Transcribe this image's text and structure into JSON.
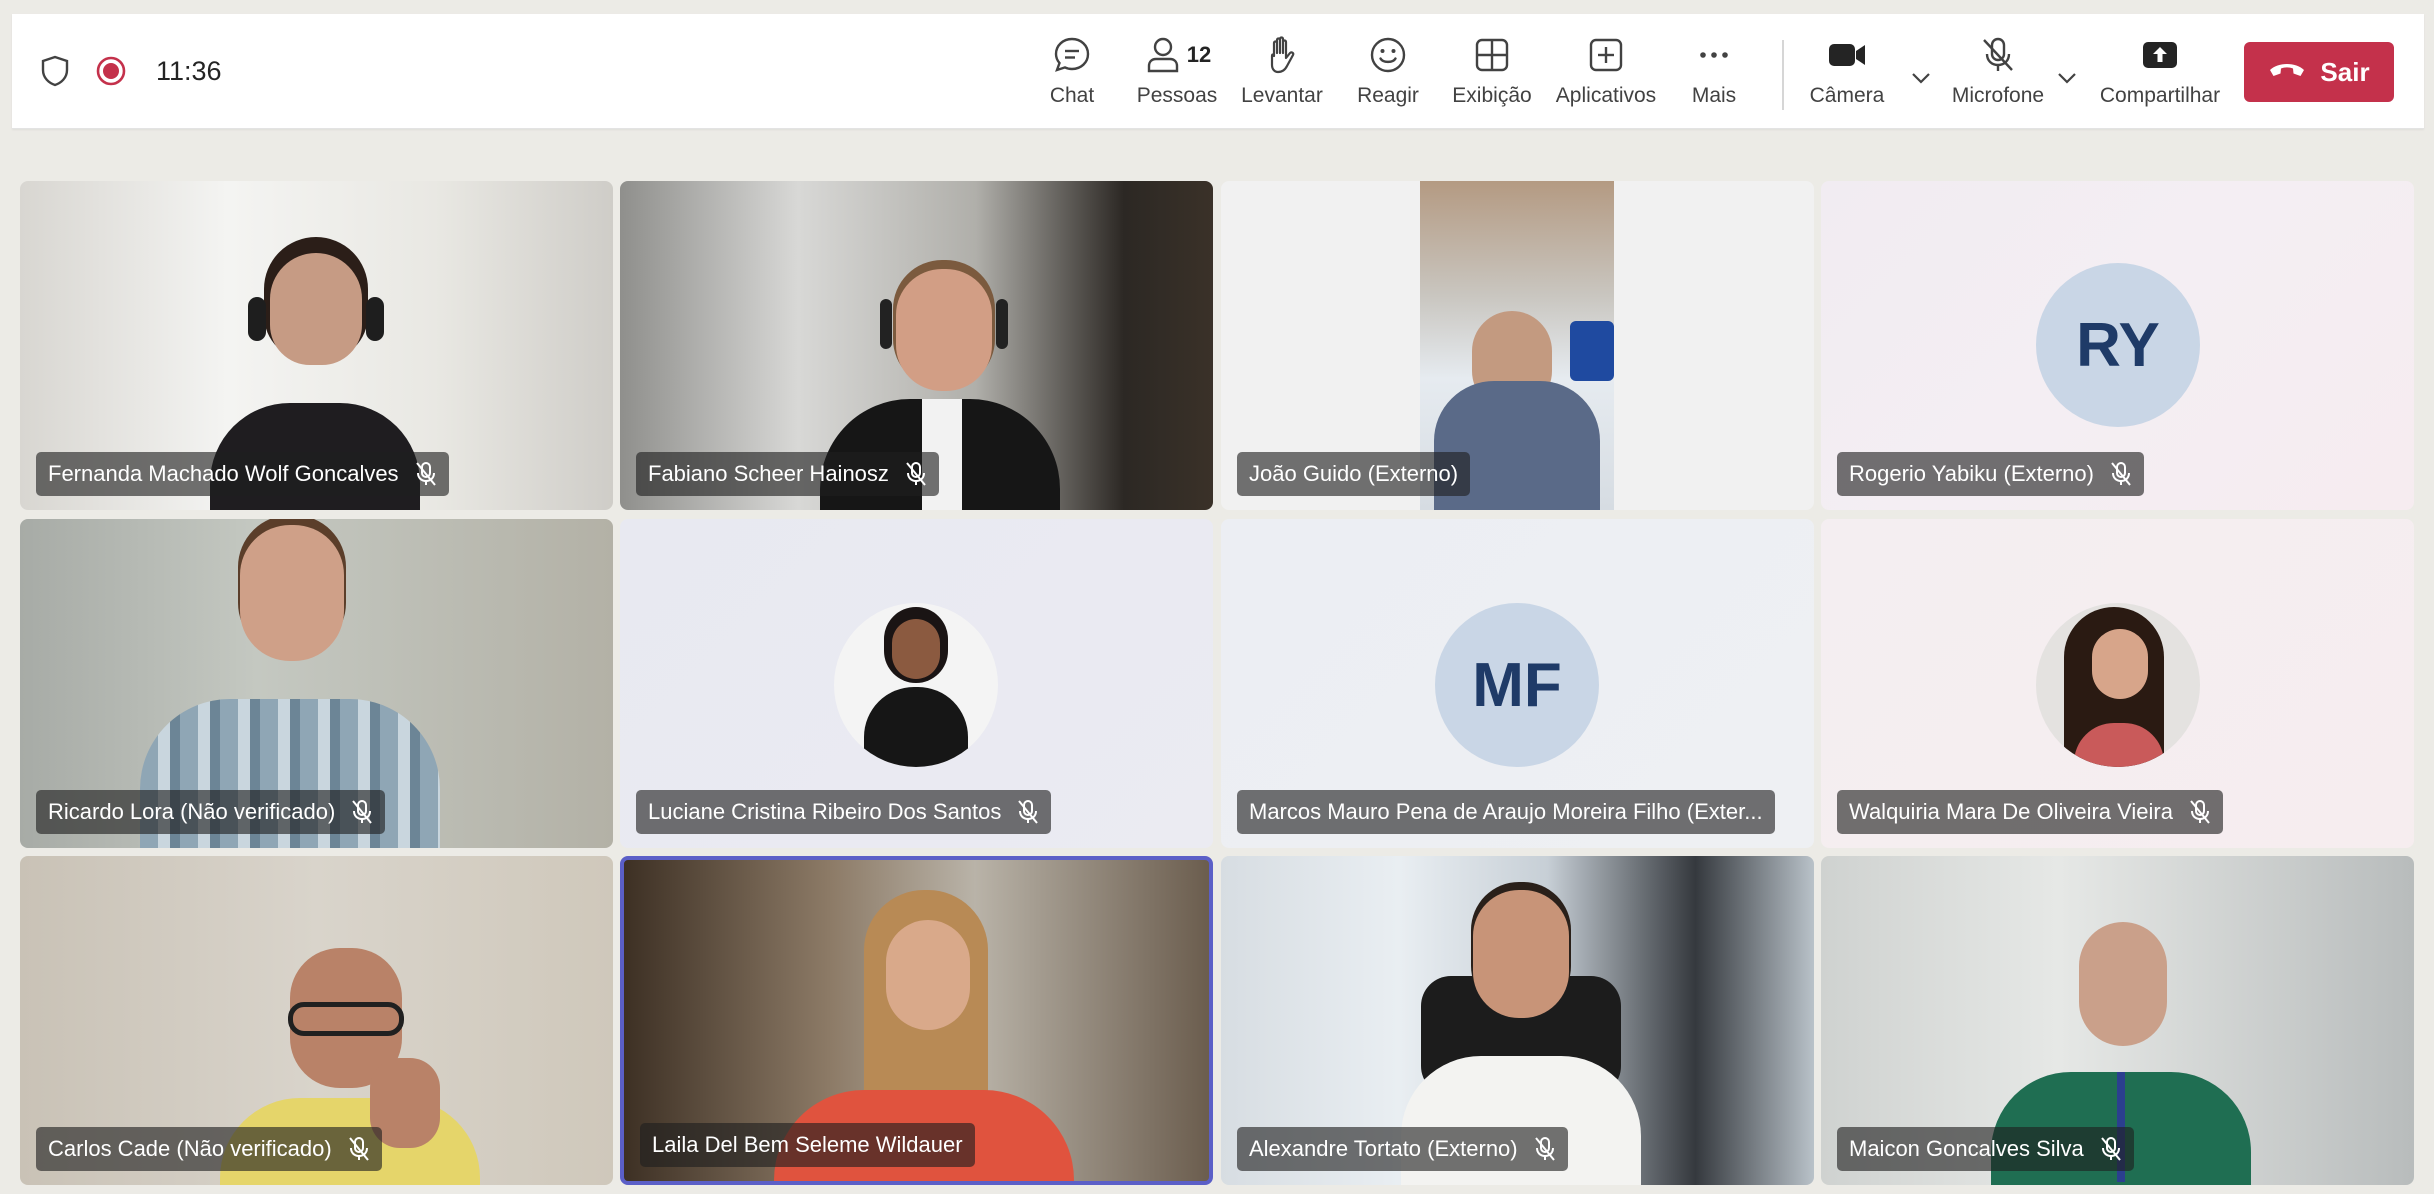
{
  "toolbar": {
    "time": "11:36",
    "chat_label": "Chat",
    "people_label": "Pessoas",
    "people_count": "12",
    "raise_label": "Levantar",
    "react_label": "Reagir",
    "view_label": "Exibição",
    "apps_label": "Aplicativos",
    "more_label": "Mais",
    "camera_label": "Câmera",
    "mic_label": "Microfone",
    "share_label": "Compartilhar",
    "leave_label": "Sair",
    "leave_color": "#c4314b",
    "accent_color": "#5b5fc7"
  },
  "participants": [
    {
      "name": "Fernanda Machado Wolf Goncalves"
    },
    {
      "name": "Fabiano Scheer Hainosz"
    },
    {
      "name": "João Guido (Externo)"
    },
    {
      "name": "Rogerio Yabiku (Externo)",
      "initials": "RY"
    },
    {
      "name": "Ricardo Lora (Não verificado)"
    },
    {
      "name": "Luciane Cristina Ribeiro Dos Santos"
    },
    {
      "name": "Marcos Mauro Pena de Araujo Moreira Filho (Exter...",
      "initials": "MF"
    },
    {
      "name": "Walquiria Mara De Oliveira Vieira"
    },
    {
      "name": "Carlos Cade (Não verificado)"
    },
    {
      "name": "Laila Del Bem Seleme Wildauer"
    },
    {
      "name": "Alexandre Tortato (Externo)"
    },
    {
      "name": "Maicon Goncalves Silva"
    }
  ]
}
